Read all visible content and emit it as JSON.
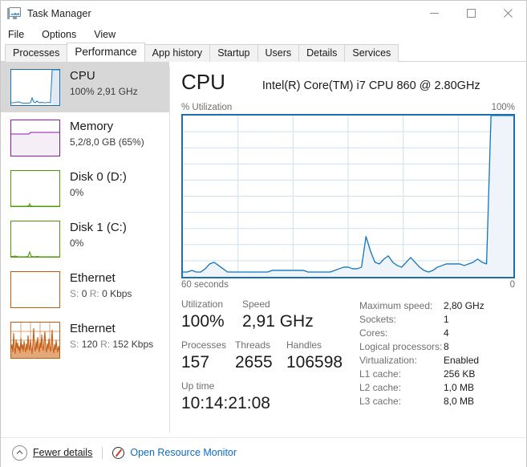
{
  "window": {
    "title": "Task Manager",
    "icon": "task-manager-icon",
    "minimize": "minimize",
    "maximize": "maximize",
    "close": "close"
  },
  "menu": {
    "items": [
      {
        "label": "File"
      },
      {
        "label": "Options"
      },
      {
        "label": "View"
      }
    ]
  },
  "tabs": [
    {
      "label": "Processes",
      "active": false
    },
    {
      "label": "Performance",
      "active": true
    },
    {
      "label": "App history",
      "active": false
    },
    {
      "label": "Startup",
      "active": false
    },
    {
      "label": "Users",
      "active": false
    },
    {
      "label": "Details",
      "active": false
    },
    {
      "label": "Services",
      "active": false
    }
  ],
  "sidebar": {
    "items": [
      {
        "title": "CPU",
        "sub": "100% 2,91 GHz",
        "color": "#1f6fad",
        "selected": true,
        "name": "sidebar-item-cpu"
      },
      {
        "title": "Memory",
        "sub": "5,2/8,0 GB (65%)",
        "color": "#9318a8",
        "selected": false,
        "name": "sidebar-item-memory"
      },
      {
        "title": "Disk 0 (D:)",
        "sub": "0%",
        "color": "#4e9a06",
        "selected": false,
        "name": "sidebar-item-disk0"
      },
      {
        "title": "Disk 1 (C:)",
        "sub": "0%",
        "color": "#4e9a06",
        "selected": false,
        "name": "sidebar-item-disk1"
      },
      {
        "title": "Ethernet",
        "sub_prefix_s": "S:",
        "sub_s": "0",
        "sub_prefix_r": "R:",
        "sub_r": "0 Kbps",
        "color": "#c55a11",
        "selected": false,
        "name": "sidebar-item-ethernet-1"
      },
      {
        "title": "Ethernet",
        "sub_prefix_s": "S:",
        "sub_s": "120",
        "sub_prefix_r": "R:",
        "sub_r": "152 Kbps",
        "color": "#c55a11",
        "selected": false,
        "name": "sidebar-item-ethernet-2"
      }
    ]
  },
  "main": {
    "title": "CPU",
    "model": "Intel(R) Core(TM) i7 CPU 860 @ 2.80GHz",
    "axis_y_label": "% Utilization",
    "axis_y_max": "100%",
    "axis_x_left": "60 seconds",
    "axis_x_right": "0",
    "stats": {
      "utilization_label": "Utilization",
      "utilization_value": "100%",
      "speed_label": "Speed",
      "speed_value": "2,91 GHz",
      "processes_label": "Processes",
      "processes_value": "157",
      "threads_label": "Threads",
      "threads_value": "2655",
      "handles_label": "Handles",
      "handles_value": "106598",
      "uptime_label": "Up time",
      "uptime_value": "10:14:21:08"
    },
    "specs": [
      {
        "label": "Maximum speed:",
        "value": "2,80 GHz"
      },
      {
        "label": "Sockets:",
        "value": "1"
      },
      {
        "label": "Cores:",
        "value": "4"
      },
      {
        "label": "Logical processors:",
        "value": "8"
      },
      {
        "label": "Virtualization:",
        "value": "Enabled"
      },
      {
        "label": "L1 cache:",
        "value": "256 KB"
      },
      {
        "label": "L2 cache:",
        "value": "1,0 MB"
      },
      {
        "label": "L3 cache:",
        "value": "8,0 MB"
      }
    ]
  },
  "statusbar": {
    "fewer_details": "Fewer details",
    "open_resource_monitor": "Open Resource Monitor"
  },
  "chart_data": {
    "type": "area",
    "title": "CPU % Utilization",
    "ylabel": "% Utilization",
    "xlabel": "60 seconds",
    "ylim": [
      0,
      100
    ],
    "xlim": [
      0,
      60
    ],
    "grid": true,
    "legend": false,
    "line_color": "#1176bc",
    "fill_color": "#eff4fa",
    "series": [
      {
        "name": "CPU Utilization",
        "values": [
          3,
          3,
          4,
          3,
          3,
          5,
          8,
          9,
          7,
          5,
          3,
          3,
          3,
          3,
          3,
          3,
          3,
          3,
          3,
          3,
          4,
          4,
          4,
          4,
          4,
          4,
          4,
          4,
          3,
          3,
          3,
          3,
          3,
          3,
          4,
          5,
          6,
          6,
          5,
          5,
          6,
          25,
          16,
          9,
          8,
          11,
          13,
          9,
          7,
          6,
          9,
          12,
          9,
          6,
          4,
          3,
          4,
          6,
          7,
          8,
          8,
          8,
          8,
          7,
          8,
          9,
          11,
          9,
          8,
          100,
          100,
          100,
          100,
          100,
          100
        ]
      }
    ]
  }
}
